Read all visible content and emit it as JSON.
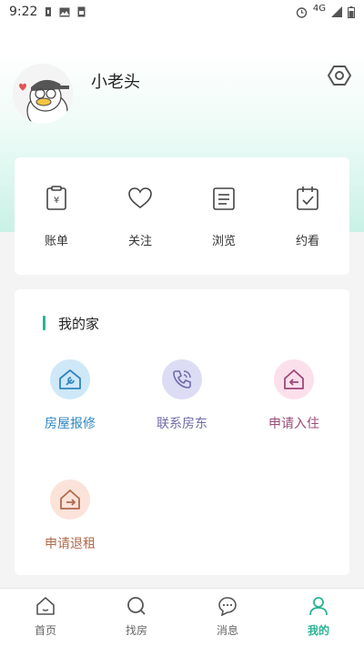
{
  "status_bar": {
    "time": "9:22",
    "network": "4G"
  },
  "profile": {
    "username": "小老头"
  },
  "quick_actions": [
    {
      "label": "账单",
      "icon": "bill-icon"
    },
    {
      "label": "关注",
      "icon": "heart-icon"
    },
    {
      "label": "浏览",
      "icon": "document-icon"
    },
    {
      "label": "约看",
      "icon": "calendar-check-icon"
    }
  ],
  "my_home": {
    "title": "我的家",
    "services": [
      {
        "label": "房屋报修",
        "icon": "house-wrench-icon",
        "color": "#2e86c1",
        "bg": "#cfe8f8"
      },
      {
        "label": "联系房东",
        "icon": "phone-icon",
        "color": "#6f6aa8",
        "bg": "#dcdcf5"
      },
      {
        "label": "申请入住",
        "icon": "house-enter-icon",
        "color": "#9a4a78",
        "bg": "#fbe0ec"
      },
      {
        "label": "申请退租",
        "icon": "house-exit-icon",
        "color": "#b06a4c",
        "bg": "#fbe3da"
      }
    ]
  },
  "tabs": [
    {
      "label": "首页",
      "icon": "home-icon",
      "active": false
    },
    {
      "label": "找房",
      "icon": "search-icon",
      "active": false
    },
    {
      "label": "消息",
      "icon": "message-icon",
      "active": false
    },
    {
      "label": "我的",
      "icon": "user-icon",
      "active": true
    }
  ],
  "colors": {
    "accent": "#2bb394"
  }
}
